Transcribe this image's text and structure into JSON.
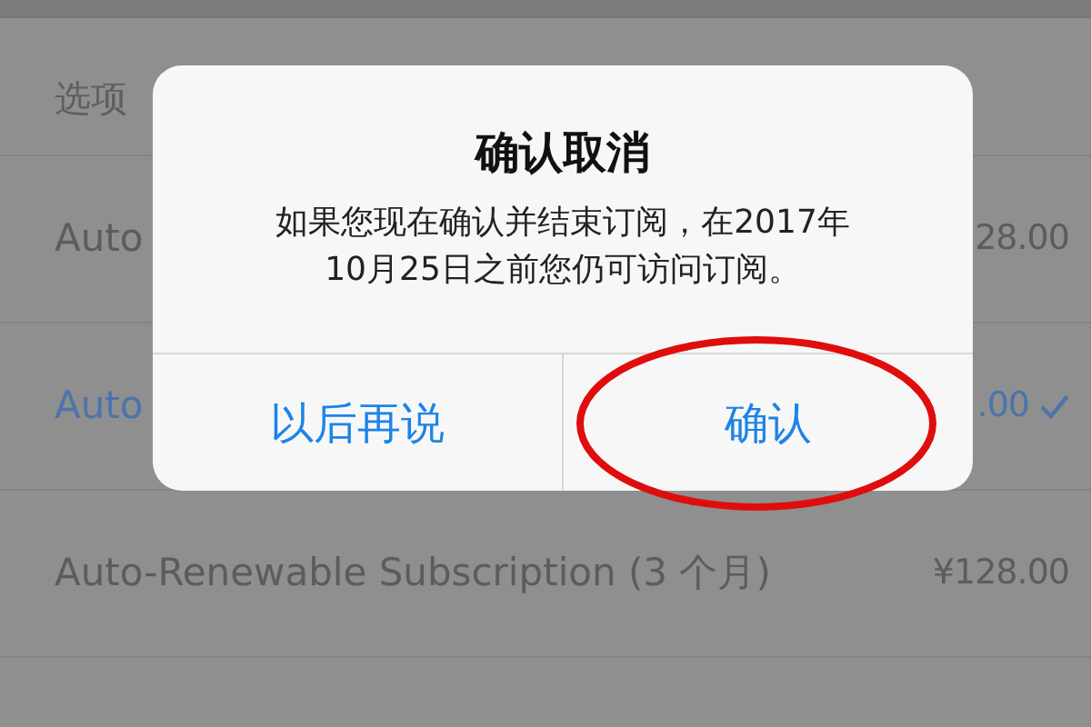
{
  "list": {
    "header": "选项",
    "rows": [
      {
        "label": "Auto",
        "price": "28.00",
        "selected": false
      },
      {
        "label": "Auto",
        "price": ".00",
        "selected": true
      },
      {
        "label": "Auto-Renewable Subscription (3 个月)",
        "price": "¥128.00",
        "selected": false
      }
    ]
  },
  "alert": {
    "title": "确认取消",
    "message_lines": [
      "如果您现在确认并结束订阅，在2017年",
      "10月25日之前您仍可访问订阅。"
    ],
    "buttons": [
      "以后再说",
      "确认"
    ]
  }
}
